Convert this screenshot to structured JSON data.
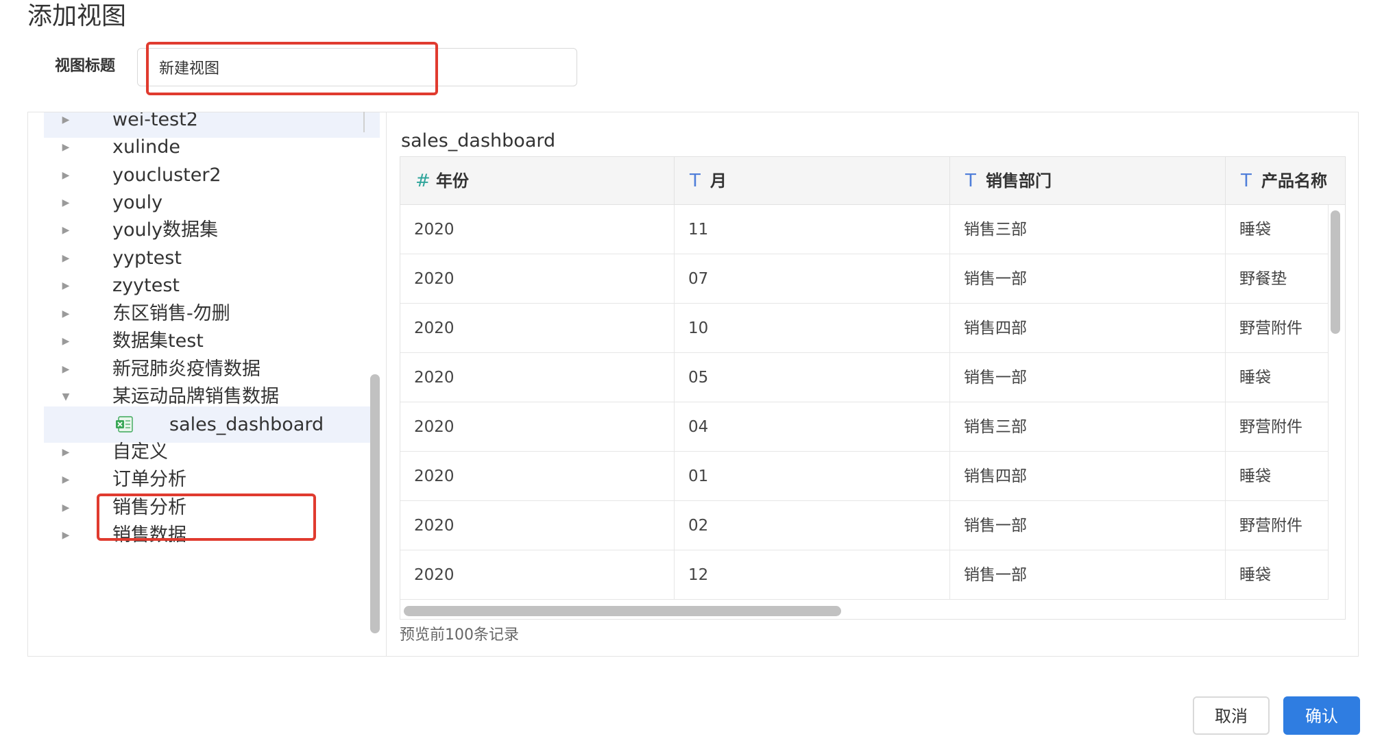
{
  "dialog": {
    "title": "添加视图",
    "title_label": "视图标题",
    "title_input_value": "新建视图"
  },
  "tree": {
    "items": [
      {
        "label": "wei-test2",
        "expanded": false
      },
      {
        "label": "xulinde",
        "expanded": false
      },
      {
        "label": "youcluster2",
        "expanded": false
      },
      {
        "label": "youly",
        "expanded": false
      },
      {
        "label": "youly数据集",
        "expanded": false
      },
      {
        "label": "yyptest",
        "expanded": false
      },
      {
        "label": "zyytest",
        "expanded": false
      },
      {
        "label": "东区销售-勿删",
        "expanded": false
      },
      {
        "label": "数据集test",
        "expanded": false
      },
      {
        "label": "新冠肺炎疫情数据",
        "expanded": false
      },
      {
        "label": "某运动品牌销售数据",
        "expanded": true
      },
      {
        "label": "自定义",
        "expanded": false
      },
      {
        "label": "订单分析",
        "expanded": false
      },
      {
        "label": "销售分析",
        "expanded": false
      },
      {
        "label": "销售数据",
        "expanded": false
      }
    ],
    "selected_child": {
      "label": "sales_dashboard",
      "icon": "excel-file-icon"
    }
  },
  "preview": {
    "title": "sales_dashboard",
    "columns": [
      {
        "type_icon": "#",
        "label": "年份"
      },
      {
        "type_icon": "T",
        "label": "月"
      },
      {
        "type_icon": "T",
        "label": "销售部门"
      },
      {
        "type_icon": "T",
        "label": "产品名称"
      }
    ],
    "rows": [
      [
        "2020",
        "11",
        "销售三部",
        "睡袋"
      ],
      [
        "2020",
        "07",
        "销售一部",
        "野餐垫"
      ],
      [
        "2020",
        "10",
        "销售四部",
        "野营附件"
      ],
      [
        "2020",
        "05",
        "销售一部",
        "睡袋"
      ],
      [
        "2020",
        "04",
        "销售三部",
        "野营附件"
      ],
      [
        "2020",
        "01",
        "销售四部",
        "睡袋"
      ],
      [
        "2020",
        "02",
        "销售一部",
        "野营附件"
      ],
      [
        "2020",
        "12",
        "销售一部",
        "睡袋"
      ]
    ],
    "note": "预览前100条记录"
  },
  "footer": {
    "cancel_label": "取消",
    "confirm_label": "确认"
  },
  "colors": {
    "primary": "#2f7de1",
    "highlight": "#e03b2f",
    "selected_bg": "#eef2fb",
    "number_type": "#2fa59b",
    "text_type": "#4f7ed9"
  }
}
